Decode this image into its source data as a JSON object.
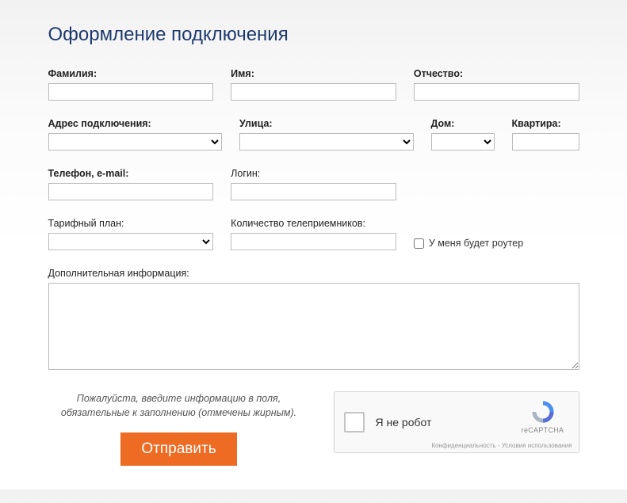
{
  "title": "Оформление подключения",
  "labels": {
    "surname": "Фамилия:",
    "name": "Имя:",
    "patronymic": "Отчество:",
    "address": "Адрес подключения:",
    "street": "Улица:",
    "house": "Дом:",
    "apartment": "Квартира:",
    "phone": "Телефон, e-mail:",
    "login": "Логин:",
    "tariff": "Тарифный план:",
    "tvcount": "Количество телеприемников:",
    "router": "У меня будет роутер",
    "extra": "Дополнительная информация:"
  },
  "hint_line1": "Пожалуйста, введите информацию в поля,",
  "hint_line2": "обязательные к заполнению (отмечены жирным).",
  "submit": "Отправить",
  "recaptcha": {
    "label": "Я не робот",
    "brand": "reCAPTCHA",
    "privacy": "Конфиденциальность",
    "terms": "Условия использования",
    "sep": " - "
  }
}
